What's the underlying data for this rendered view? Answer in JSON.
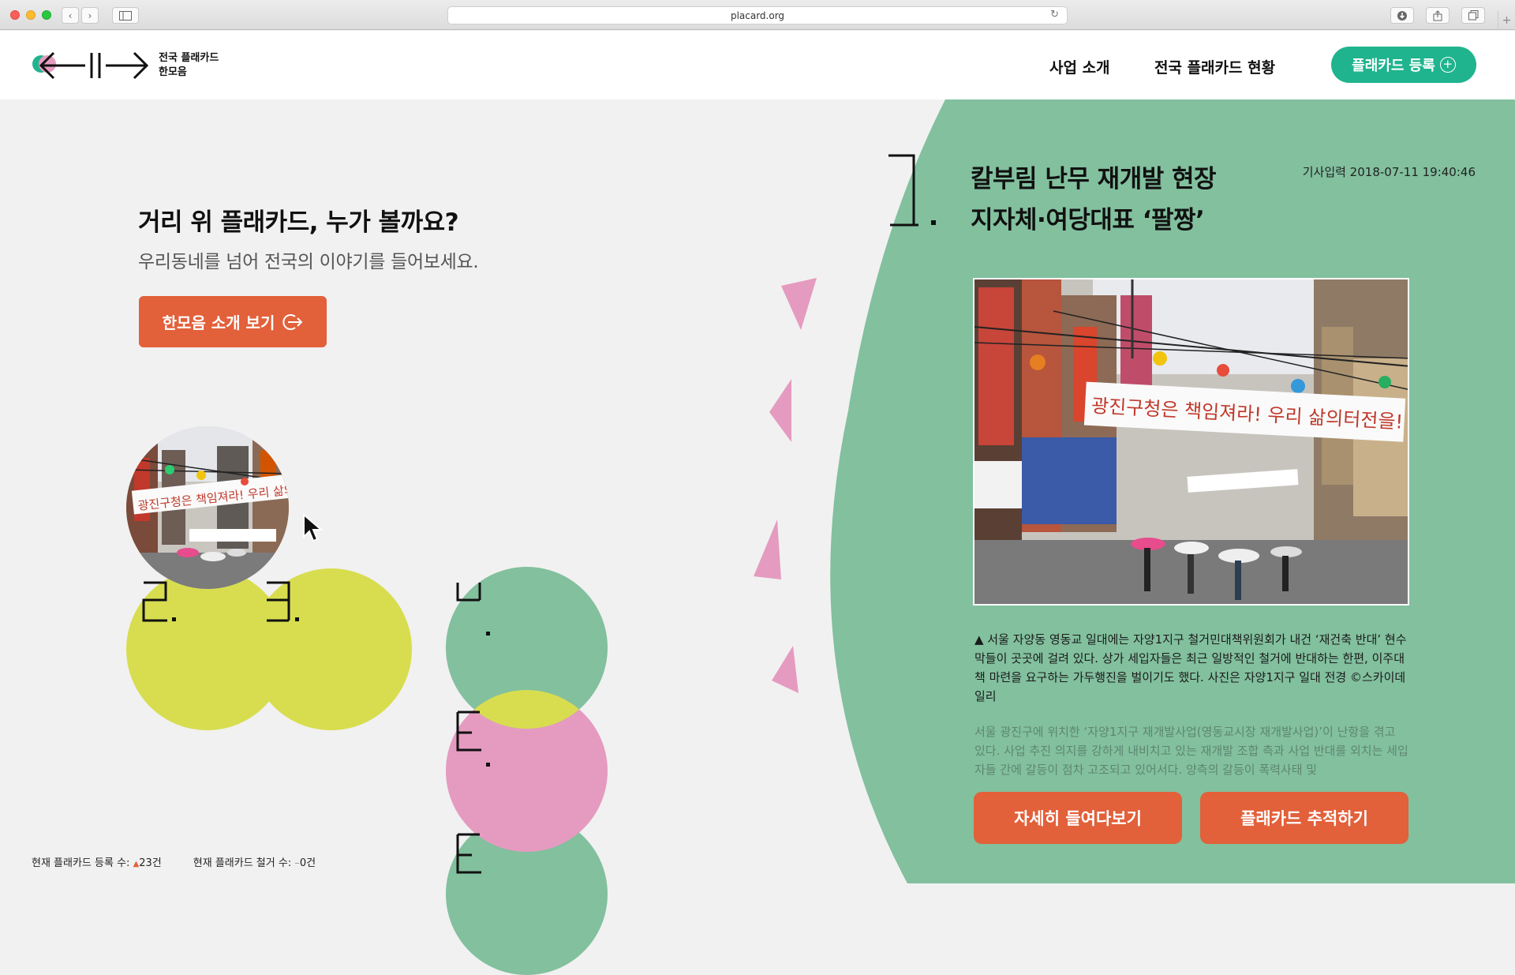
{
  "browser": {
    "url": "placard.org"
  },
  "header": {
    "logo_line1": "전국 플래카드",
    "logo_line2": "한모음",
    "nav": [
      "사업 소개",
      "전국 플래카드 현황"
    ],
    "register_label": "플래카드 등록"
  },
  "hero": {
    "title": "거리 위 플래카드, 누가 볼까요?",
    "subtitle": "우리동네를 넘어 전국의 이야기를 들어보세요.",
    "intro_button": "한모음 소개 보기"
  },
  "counters": {
    "registered_label": "현재 플래카드 등록 수:",
    "registered_value": "23건",
    "removed_label": "현재 플래카드 철거 수:",
    "removed_value": "0건"
  },
  "article": {
    "title_line1": "칼부림 난무 재개발 현장",
    "title_line2": "지자체·여당대표 ‘팔짱’",
    "date": "기사입력 2018-07-11 19:40:46",
    "banner_text": "광진구청은 책임져라! 우리 삶의터전을!",
    "caption": "▲ 서울 자양동 영동교 일대에는 자양1지구 철거민대책위원회가 내건 ‘재건축 반대’ 현수막들이 곳곳에 걸려 있다. 상가 세입자들은 최근 일방적인 철거에 반대하는 한편, 이주대책 마련을 요구하는 가두행진을 벌이기도 했다. 사진은 자양1지구 일대 전경 ©스카이데일리",
    "body": "서울 광진구에 위치한 ‘자양1지구 재개발사업(영동교시장 재개발사업)’이 난항을 겪고 있다. 사업 추진 의지를 강하게 내비치고 있는 재개발 조합 측과 사업 반대를 외치는 세입자들 간에 갈등이 점차 고조되고 있어서다. 양측의 갈등이 폭력사태 및",
    "btn_detail": "자세히 들여다보기",
    "btn_track": "플래카드 추적하기"
  },
  "colors": {
    "accent_orange": "#e2603a",
    "brand_green": "#1fb48e",
    "panel_green": "#82c09e",
    "lime": "#d8dd4f",
    "pink": "#e59bc0"
  }
}
